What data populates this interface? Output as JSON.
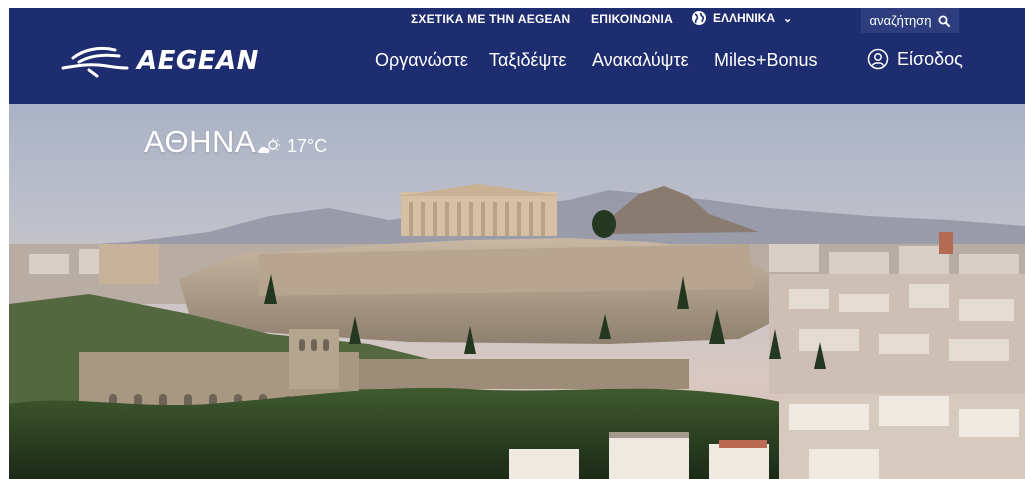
{
  "header": {
    "logo_text": "AEGEAN",
    "top_links": {
      "about": "ΣΧΕΤΙΚΑ ΜΕ ΤΗΝ AEGEAN",
      "contact": "ΕΠΙΚΟΙΝΩΝΙΑ"
    },
    "language": {
      "label": "ΕΛΛΗΝΙΚΑ",
      "icon": "globe-icon"
    },
    "search": {
      "label": "αναζήτηση",
      "icon": "search-icon"
    },
    "nav": {
      "organize": "Οργανώστε",
      "travel": "Ταξιδέψτε",
      "discover": "Ανακαλύψτε",
      "miles": "Miles+Bonus"
    },
    "login": {
      "label": "Είσοδος",
      "icon": "user-icon"
    }
  },
  "hero": {
    "city": "ΑΘΗΝΑ",
    "weather": {
      "icon": "partly-cloudy-icon",
      "temperature": "17°C"
    }
  },
  "colors": {
    "header_bg": "#1e2d6f",
    "search_bg": "#2d3d7e",
    "text": "#ffffff"
  }
}
